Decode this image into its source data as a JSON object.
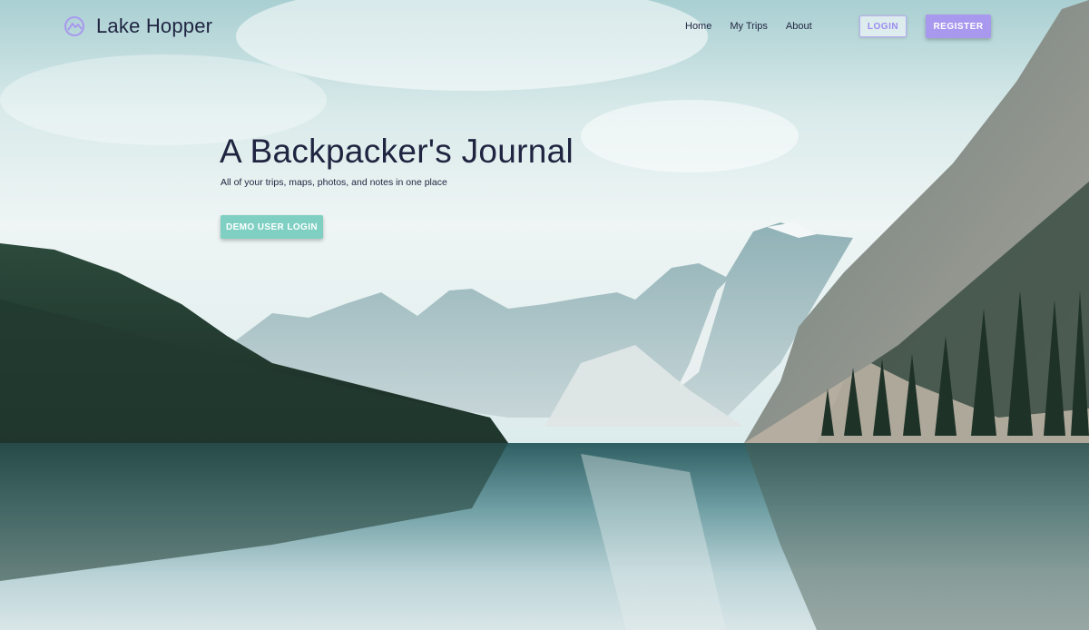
{
  "brand": {
    "name": "Lake Hopper",
    "icon": "mountain-circle-icon",
    "color": "#a898ee"
  },
  "nav": {
    "links": [
      {
        "label": "Home"
      },
      {
        "label": "My Trips"
      },
      {
        "label": "About"
      }
    ],
    "login_label": "LOGIN",
    "register_label": "REGISTER"
  },
  "hero": {
    "title": "A Backpacker's Journal",
    "subtitle": "All of your trips, maps, photos, and notes in one place",
    "demo_label": "DEMO USER LOGIN",
    "background": "mountain-lake-photo"
  },
  "colors": {
    "accent_purple": "#a898ee",
    "accent_teal": "#7fd0c3",
    "text_dark": "#1f2440"
  }
}
